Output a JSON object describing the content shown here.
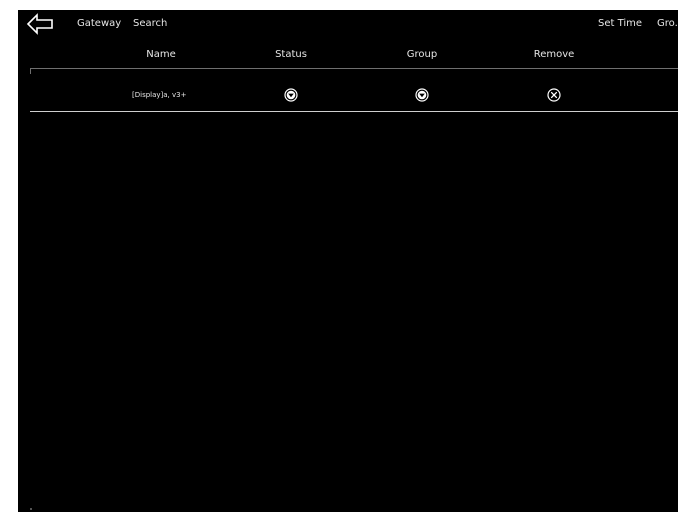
{
  "topbar": {
    "back_icon": "left-arrow-icon",
    "gateway_label": "Gateway",
    "search_label": "Search",
    "set_time_label": "Set Time",
    "group_truncated_label": "Gro..."
  },
  "table": {
    "headers": {
      "name": "Name",
      "status": "Status",
      "group": "Group",
      "remove": "Remove"
    },
    "rows": [
      {
        "name": "[Display]a, v3+",
        "status_icon": "chevron-down-circle-icon",
        "group_icon": "chevron-down-circle-icon",
        "remove_icon": "close-circle-icon"
      }
    ]
  },
  "colors": {
    "background": "#000000",
    "text": "#e6e6e6",
    "divider": "#cfcfcf"
  }
}
